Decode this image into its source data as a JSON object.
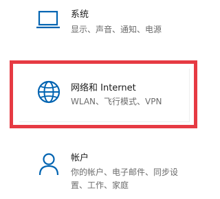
{
  "settings": {
    "system": {
      "title": "系统",
      "description": "显示、声音、通知、电源",
      "icon": "laptop-icon"
    },
    "network": {
      "title": "网络和 Internet",
      "description": "WLAN、飞行模式、VPN",
      "icon": "globe-icon"
    },
    "accounts": {
      "title": "帐户",
      "description_line1": "你的帐户、电子邮件、同步设",
      "description_line2": "置、工作、家庭",
      "icon": "person-icon"
    }
  },
  "colors": {
    "accent": "#0063b1",
    "highlight": "#e63a43",
    "title_text": "#1a1a1a",
    "description_text": "#6b6b6b"
  }
}
